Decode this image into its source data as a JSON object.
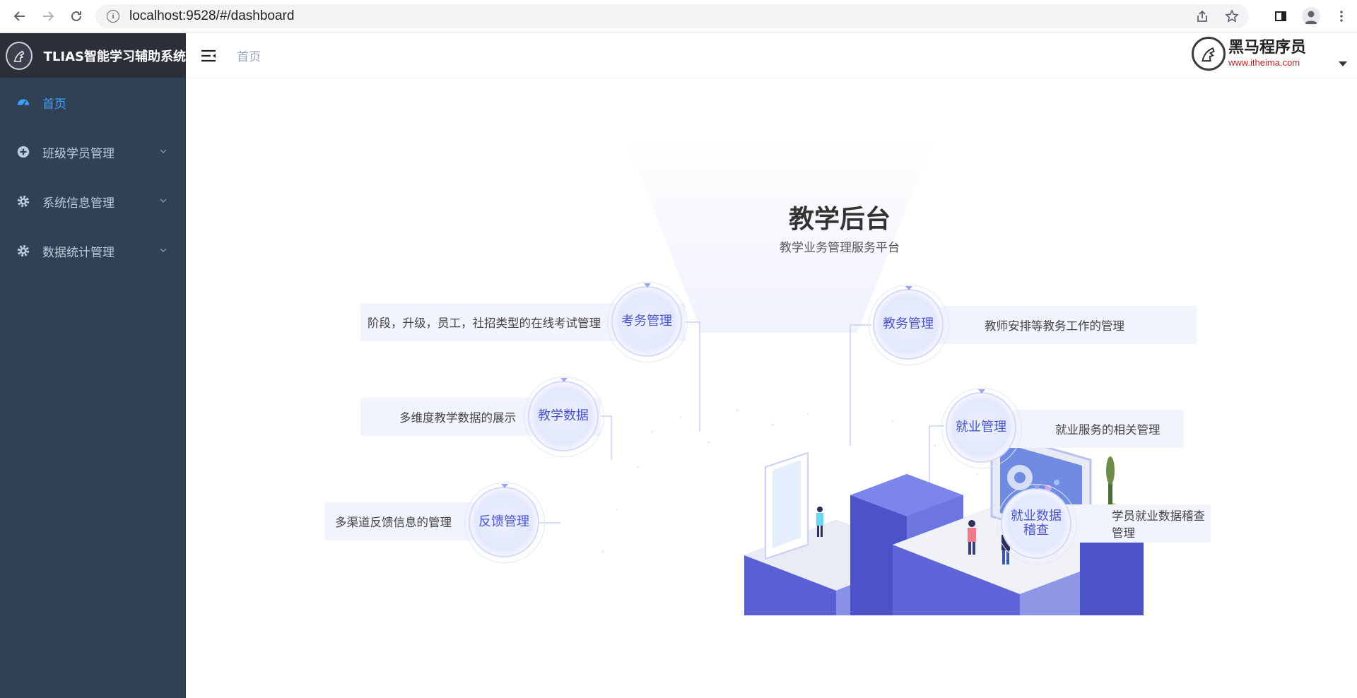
{
  "browser": {
    "url": "localhost:9528/#/dashboard"
  },
  "sidebar": {
    "brand_title": "TLIAS智能学习辅助系统",
    "items": [
      {
        "label": "首页",
        "icon": "dashboard-icon",
        "active": true
      },
      {
        "label": "班级学员管理",
        "icon": "plus-circle-icon"
      },
      {
        "label": "系统信息管理",
        "icon": "gear-icon"
      },
      {
        "label": "数据统计管理",
        "icon": "gear-icon"
      }
    ]
  },
  "header": {
    "breadcrumb": "首页",
    "brand_name": "黑马程序员",
    "brand_site": "www.itheima.com"
  },
  "dashboard": {
    "title": "教学后台",
    "subtitle": "教学业务管理服务平台",
    "modules": [
      {
        "name": "考务管理",
        "desc": "阶段，升级，员工，社招类型的在线考试管理"
      },
      {
        "name": "教学数据",
        "desc": "多维度教学数据的展示"
      },
      {
        "name": "反馈管理",
        "desc": "多渠道反馈信息的管理"
      },
      {
        "name": "教务管理",
        "desc": "教师安排等教务工作的管理"
      },
      {
        "name": "就业管理",
        "desc": "就业服务的相关管理"
      },
      {
        "name": "就业数据稽查",
        "name_line1": "就业数据",
        "name_line2": "稽查",
        "desc": "学员就业数据稽查管理"
      }
    ]
  },
  "colors": {
    "sidebar_bg": "#304156",
    "brand_bg": "#2b2f3a",
    "active": "#409eff",
    "node_text": "#4a55c9"
  }
}
